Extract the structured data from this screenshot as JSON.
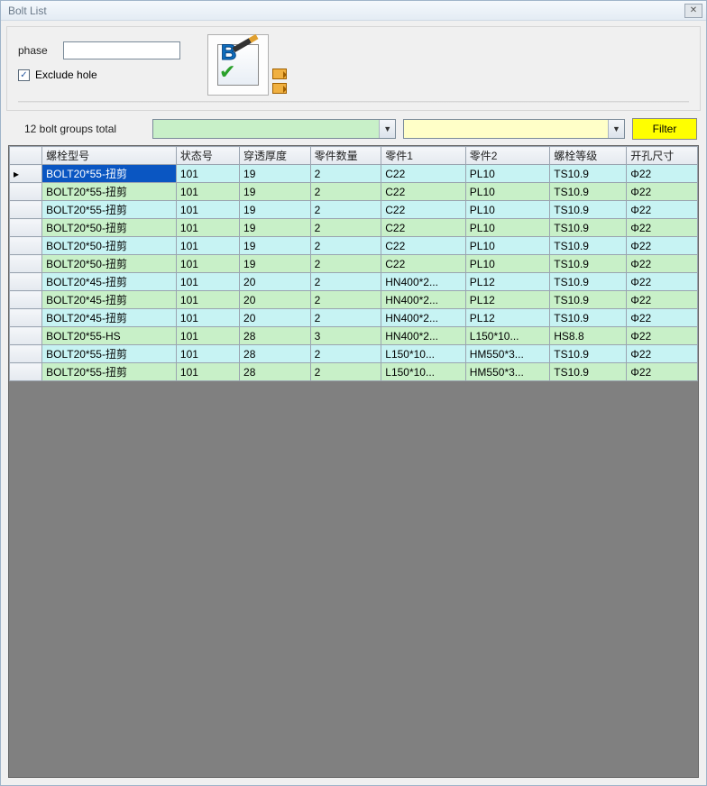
{
  "window": {
    "title": "Bolt List",
    "close": "✕"
  },
  "top": {
    "phase_label": "phase",
    "phase_value": "",
    "exclude_checked": true,
    "exclude_label": "Exclude hole"
  },
  "filter": {
    "total_label": "12 bolt groups total",
    "combo_green_value": "",
    "combo_yellow_value": "",
    "button_label": "Filter"
  },
  "table": {
    "columns": [
      "螺栓型号",
      "状态号",
      "穿透厚度",
      "零件数量",
      "零件1",
      "零件2",
      "螺栓等级",
      "开孔尺寸"
    ],
    "rows": [
      {
        "color": "cyan",
        "selected": true,
        "cells": [
          "BOLT20*55-扭剪",
          "101",
          "19",
          "2",
          "C22",
          "PL10",
          "TS10.9",
          "Φ22"
        ]
      },
      {
        "color": "green",
        "selected": false,
        "cells": [
          "BOLT20*55-扭剪",
          "101",
          "19",
          "2",
          "C22",
          "PL10",
          "TS10.9",
          "Φ22"
        ]
      },
      {
        "color": "cyan",
        "selected": false,
        "cells": [
          "BOLT20*55-扭剪",
          "101",
          "19",
          "2",
          "C22",
          "PL10",
          "TS10.9",
          "Φ22"
        ]
      },
      {
        "color": "green",
        "selected": false,
        "cells": [
          "BOLT20*50-扭剪",
          "101",
          "19",
          "2",
          "C22",
          "PL10",
          "TS10.9",
          "Φ22"
        ]
      },
      {
        "color": "cyan",
        "selected": false,
        "cells": [
          "BOLT20*50-扭剪",
          "101",
          "19",
          "2",
          "C22",
          "PL10",
          "TS10.9",
          "Φ22"
        ]
      },
      {
        "color": "green",
        "selected": false,
        "cells": [
          "BOLT20*50-扭剪",
          "101",
          "19",
          "2",
          "C22",
          "PL10",
          "TS10.9",
          "Φ22"
        ]
      },
      {
        "color": "cyan",
        "selected": false,
        "cells": [
          "BOLT20*45-扭剪",
          "101",
          "20",
          "2",
          "HN400*2...",
          "PL12",
          "TS10.9",
          "Φ22"
        ]
      },
      {
        "color": "green",
        "selected": false,
        "cells": [
          "BOLT20*45-扭剪",
          "101",
          "20",
          "2",
          "HN400*2...",
          "PL12",
          "TS10.9",
          "Φ22"
        ]
      },
      {
        "color": "cyan",
        "selected": false,
        "cells": [
          "BOLT20*45-扭剪",
          "101",
          "20",
          "2",
          "HN400*2...",
          "PL12",
          "TS10.9",
          "Φ22"
        ]
      },
      {
        "color": "green",
        "selected": false,
        "cells": [
          "BOLT20*55-HS",
          "101",
          "28",
          "3",
          "HN400*2...",
          "L150*10...",
          "HS8.8",
          "Φ22"
        ]
      },
      {
        "color": "cyan",
        "selected": false,
        "cells": [
          "BOLT20*55-扭剪",
          "101",
          "28",
          "2",
          "L150*10...",
          "HM550*3...",
          "TS10.9",
          "Φ22"
        ]
      },
      {
        "color": "green",
        "selected": false,
        "cells": [
          "BOLT20*55-扭剪",
          "101",
          "28",
          "2",
          "L150*10...",
          "HM550*3...",
          "TS10.9",
          "Φ22"
        ]
      }
    ]
  }
}
